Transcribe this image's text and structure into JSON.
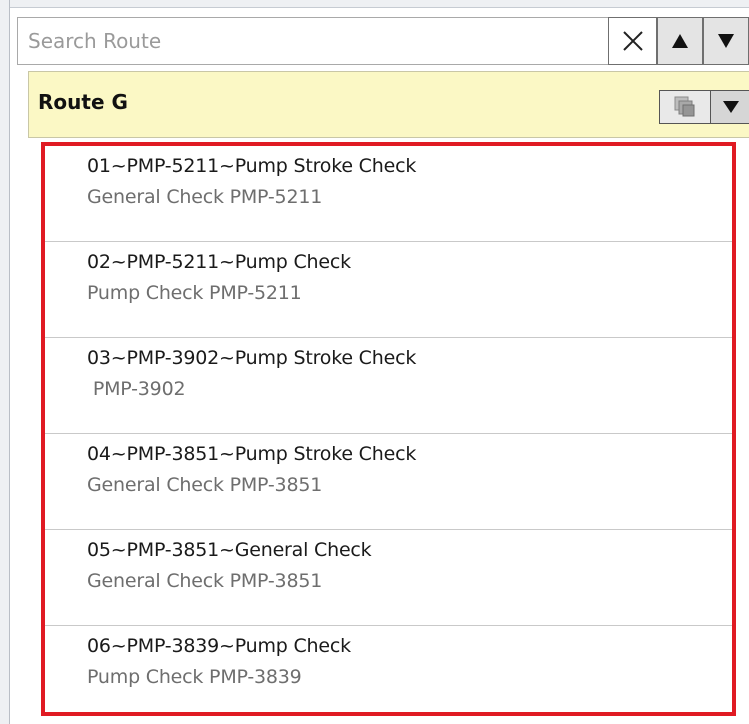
{
  "search": {
    "placeholder": "Search Route",
    "value": ""
  },
  "route": {
    "title": "Route G"
  },
  "items": [
    {
      "title": "01~PMP-5211~Pump Stroke Check",
      "subtitle": "General Check PMP-5211"
    },
    {
      "title": "02~PMP-5211~Pump Check",
      "subtitle": "Pump Check PMP-5211"
    },
    {
      "title": "03~PMP-3902~Pump Stroke Check",
      "subtitle": " PMP-3902"
    },
    {
      "title": "04~PMP-3851~Pump Stroke Check",
      "subtitle": "General Check PMP-3851"
    },
    {
      "title": "05~PMP-3851~General Check",
      "subtitle": "General Check PMP-3851"
    },
    {
      "title": "06~PMP-3839~Pump Check",
      "subtitle": "Pump Check PMP-3839"
    }
  ],
  "icons": {
    "clear": "close-icon",
    "up": "arrow-up-icon",
    "down": "arrow-down-icon",
    "copy": "copy-icon",
    "dropdown": "chevron-down-icon"
  },
  "colors": {
    "highlight_border": "#e01a23",
    "route_header_bg": "#fbf8c5"
  }
}
